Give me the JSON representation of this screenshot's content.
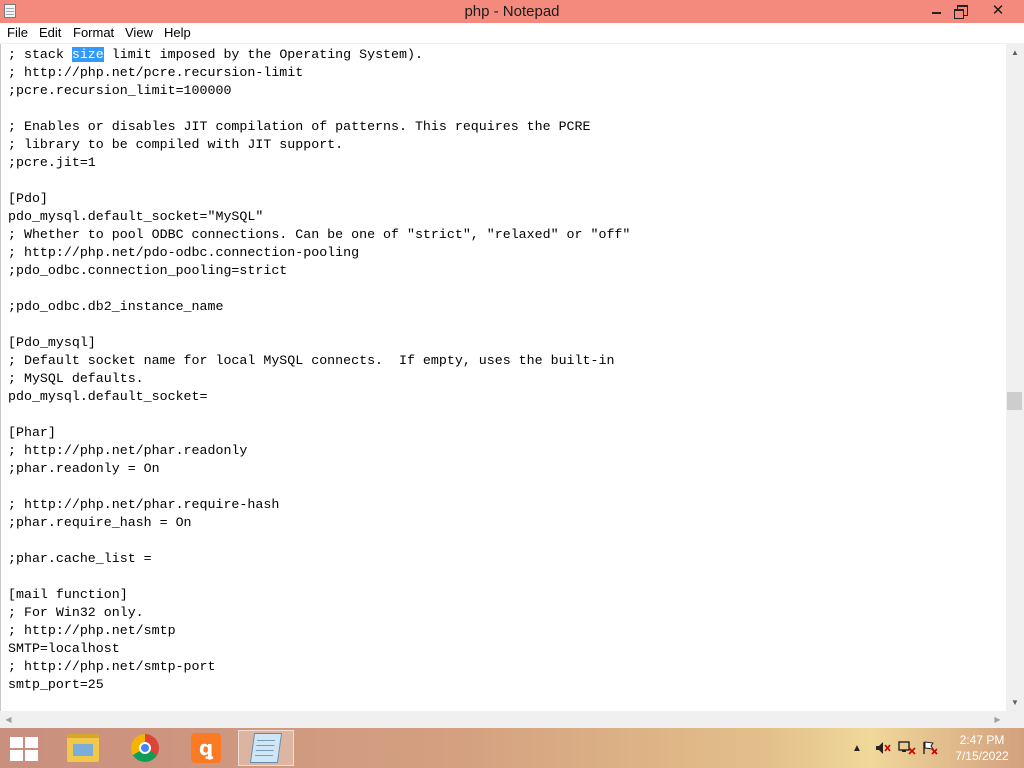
{
  "window": {
    "title": "php - Notepad"
  },
  "menu": [
    "File",
    "Edit",
    "Format",
    "View",
    "Help"
  ],
  "editor": {
    "selected_word": "size",
    "lines": [
      "; stack size limit imposed by the Operating System).",
      "; http://php.net/pcre.recursion-limit",
      ";pcre.recursion_limit=100000",
      "",
      "; Enables or disables JIT compilation of patterns. This requires the PCRE",
      "; library to be compiled with JIT support.",
      ";pcre.jit=1",
      "",
      "[Pdo]",
      "pdo_mysql.default_socket=\"MySQL\"",
      "; Whether to pool ODBC connections. Can be one of \"strict\", \"relaxed\" or \"off\"",
      "; http://php.net/pdo-odbc.connection-pooling",
      ";pdo_odbc.connection_pooling=strict",
      "",
      ";pdo_odbc.db2_instance_name",
      "",
      "[Pdo_mysql]",
      "; Default socket name for local MySQL connects.  If empty, uses the built-in",
      "; MySQL defaults.",
      "pdo_mysql.default_socket=",
      "",
      "[Phar]",
      "; http://php.net/phar.readonly",
      ";phar.readonly = On",
      "",
      "; http://php.net/phar.require-hash",
      ";phar.require_hash = On",
      "",
      ";phar.cache_list =",
      "",
      "[mail function]",
      "; For Win32 only.",
      "; http://php.net/smtp",
      "SMTP=localhost",
      "; http://php.net/smtp-port",
      "smtp_port=25"
    ]
  },
  "taskbar": {
    "apps": [
      {
        "name": "file-explorer",
        "icon": "folder-icon"
      },
      {
        "name": "chrome",
        "icon": "chrome-icon"
      },
      {
        "name": "xampp",
        "icon": "xampp-icon"
      },
      {
        "name": "notepad",
        "icon": "notepad-icon",
        "active": true
      }
    ],
    "xampp_glyph": "ꝗ",
    "clock_time": "2:47 PM",
    "clock_date": "7/15/2022"
  },
  "colors": {
    "titlebar": "#f48a7e",
    "selection": "#3399ff"
  }
}
